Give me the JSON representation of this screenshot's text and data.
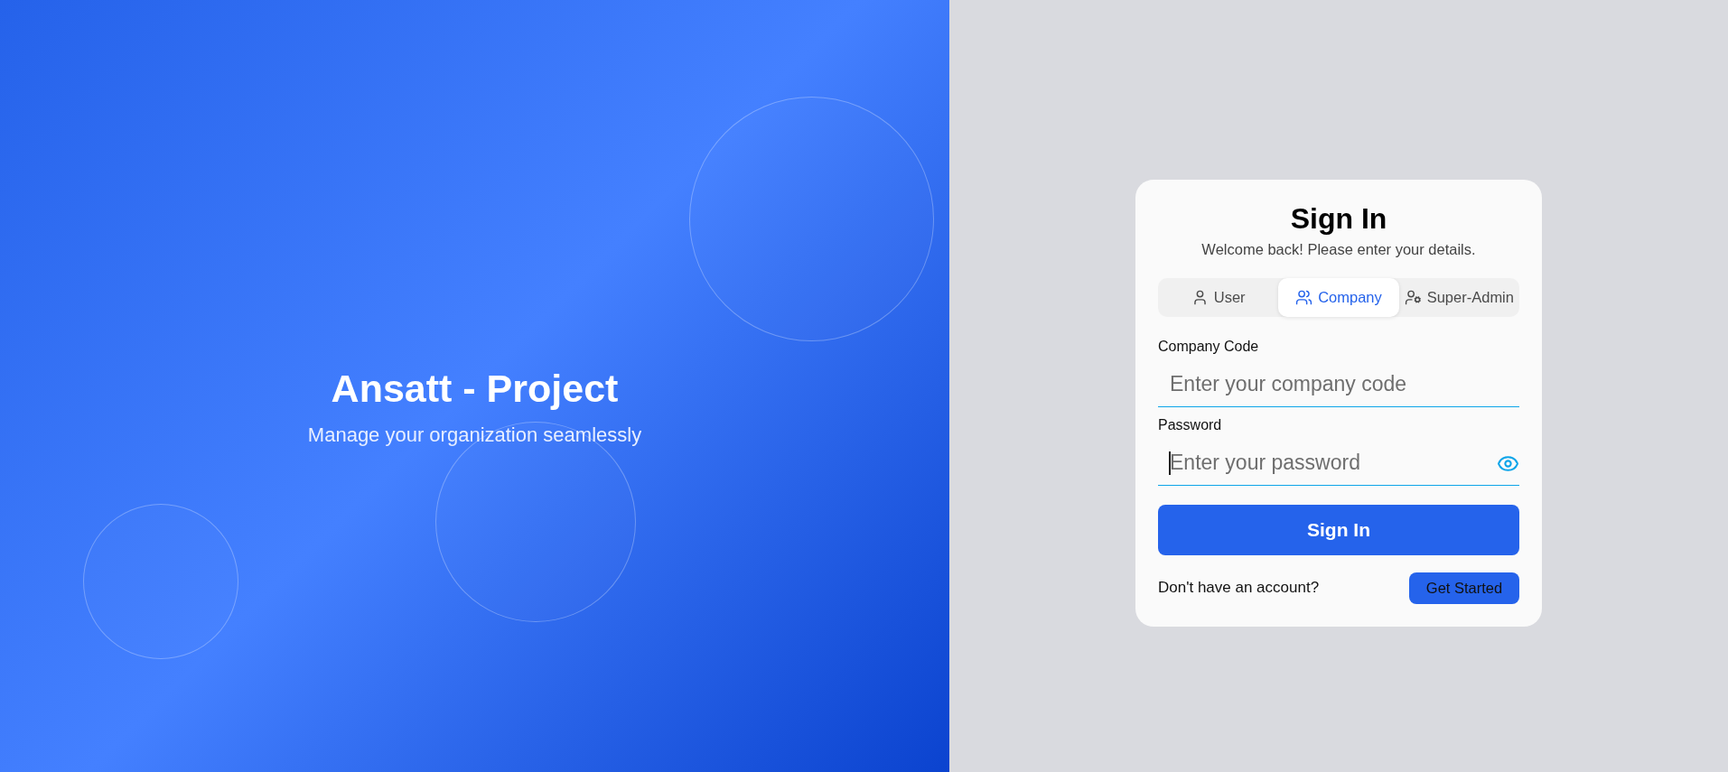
{
  "brand": {
    "title": "Ansatt - Project",
    "tagline": "Manage your organization seamlessly"
  },
  "sign_in": {
    "title": "Sign In",
    "subtitle": "Welcome back! Please enter your details.",
    "tabs": [
      {
        "label": "User",
        "selected": false
      },
      {
        "label": "Company",
        "selected": true
      },
      {
        "label": "Super-Admin",
        "selected": false
      }
    ],
    "fields": [
      {
        "label": "Company Code",
        "placeholder": "Enter your company code",
        "kind": "text",
        "focused": false
      },
      {
        "label": "Password",
        "placeholder": "Enter your password",
        "kind": "password",
        "focused": true
      }
    ],
    "submit": "Sign In",
    "footer": {
      "prompt": "Don't have an account?",
      "action": "Get Started"
    }
  }
}
